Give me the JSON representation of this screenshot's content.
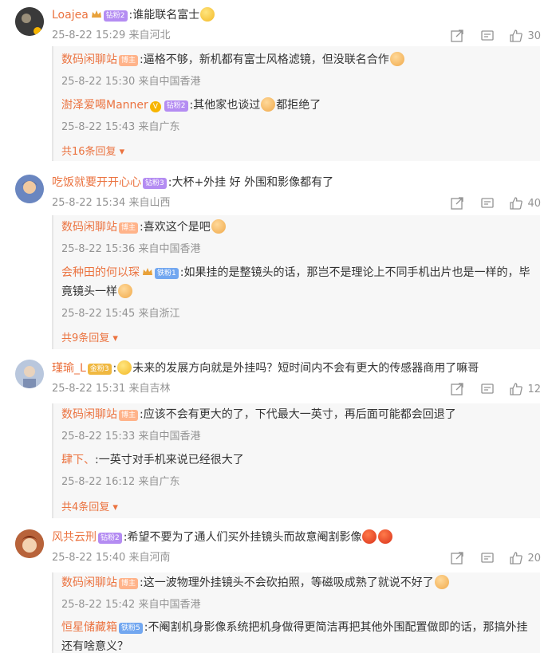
{
  "comments": [
    {
      "user": "Loajea",
      "badge": "钻粉2",
      "text": ":谁能联名富士",
      "time": "25-8-22 15:29",
      "location": "来自河北",
      "likes": "30",
      "replies": [
        {
          "user": "数码闲聊站",
          "tag": "博主",
          "text": ":逼格不够，新机都有富士风格滤镜，但没联名合作",
          "time": "25-8-22 15:30",
          "location": "来自中国香港"
        },
        {
          "user": "澍泽爱喝Manner",
          "badge": "钻粉2",
          "text": ":其他家也谈过",
          "text2": "都拒绝了",
          "time": "25-8-22 15:43",
          "location": "来自广东"
        }
      ],
      "more": "共16条回复"
    },
    {
      "user": "吃饭就要开开心心",
      "badge": "钻粉3",
      "text": ":大杯+外挂  好  外围和影像都有了",
      "time": "25-8-22 15:34",
      "location": "来自山西",
      "likes": "40",
      "replies": [
        {
          "user": "数码闲聊站",
          "tag": "博主",
          "text": ":喜欢这个是吧",
          "time": "25-8-22 15:36",
          "location": "来自中国香港"
        },
        {
          "user": "会种田的何以琛",
          "badge": "铁粉1",
          "text": ":如果挂的是整镜头的话，那岂不是理论上不同手机出片也是一样的，毕竟镜头一样",
          "time": "25-8-22 15:45",
          "location": "来自浙江"
        }
      ],
      "more": "共9条回复"
    },
    {
      "user": "瑾瑜_L",
      "badge": "金粉3",
      "text": "未来的发展方向就是外挂吗？短时间内不会有更大的传感器商用了嘛哥",
      "time": "25-8-22 15:31",
      "location": "来自吉林",
      "likes": "12",
      "replies": [
        {
          "user": "数码闲聊站",
          "tag": "博主",
          "text": ":应该不会有更大的了，下代最大一英寸，再后面可能都会回退了",
          "time": "25-8-22 15:33",
          "location": "来自中国香港"
        },
        {
          "user": "肆下、",
          "text": ":一英寸对手机来说已经很大了",
          "time": "25-8-22 16:12",
          "location": "来自广东"
        }
      ],
      "more": "共4条回复"
    },
    {
      "user": "风共云刑",
      "badge": "钻粉2",
      "text": ":希望不要为了通人们买外挂镜头而故意阉割影像",
      "time": "25-8-22 15:40",
      "location": "来自河南",
      "likes": "20",
      "replies": [
        {
          "user": "数码闲聊站",
          "tag": "博主",
          "text": ":这一波物理外挂镜头不会砍拍照，等磁吸成熟了就说不好了",
          "time": "25-8-22 15:42",
          "location": "来自中国香港"
        },
        {
          "user": "恒星储藏箱",
          "badge": "铁粉5",
          "text": ":不阉割机身影像系统把机身做得更简洁再把其他外围配置做即的话，那搞外挂还有啥意义？"
        }
      ]
    }
  ]
}
